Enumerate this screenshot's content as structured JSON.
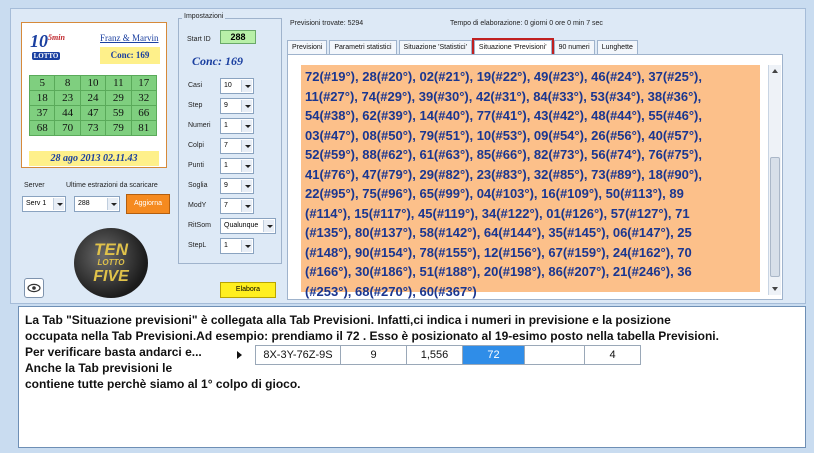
{
  "ticket": {
    "logo_main": "10",
    "logo_five": "5",
    "logo_min": "min",
    "logo_lotto": "LOTTO",
    "authors": "Franz & Marvin",
    "conc": "Conc: 169",
    "numbers": [
      5,
      8,
      10,
      11,
      17,
      18,
      23,
      24,
      29,
      32,
      37,
      44,
      47,
      59,
      66,
      68,
      70,
      73,
      79,
      81
    ],
    "date": "28 ago 2013 02.11.43"
  },
  "server": {
    "server_label": "Server",
    "extractions_label": "Ultime estrazioni da scaricare",
    "server_value": "Serv 1",
    "extractions_value": "288",
    "update_button": "Aggiorna"
  },
  "logo_tenlotto": {
    "line1": "TEN",
    "line2": "LOTTO",
    "line3": "FIVE"
  },
  "settings": {
    "title": "Impostazioni",
    "start_id_label": "Start ID",
    "start_id_value": "288",
    "conc": "Conc: 169",
    "fields": [
      {
        "label": "Casi",
        "value": "10"
      },
      {
        "label": "Step",
        "value": "9"
      },
      {
        "label": "Numeri",
        "value": "1"
      },
      {
        "label": "Colpi",
        "value": "7"
      },
      {
        "label": "Punti",
        "value": "1"
      },
      {
        "label": "Soglia",
        "value": "9"
      },
      {
        "label": "ModY",
        "value": "7"
      },
      {
        "label": "RitSom",
        "value": "Qualunque"
      },
      {
        "label": "StepL",
        "value": "1"
      }
    ],
    "elabora_button": "Elabora"
  },
  "status": {
    "found": "Previsioni trovate: 5294",
    "elapsed": "Tempo di elaborazione: 0 giorni 0 ore 0 min 7 sec"
  },
  "tabs": [
    {
      "label": "Previsioni"
    },
    {
      "label": "Parametri statistici"
    },
    {
      "label": "Situazione 'Statistici'"
    },
    {
      "label": "Situazione 'Previsioni'"
    },
    {
      "label": "90 numeri"
    },
    {
      "label": "Lunghette"
    }
  ],
  "active_tab": "Situazione 'Previsioni'",
  "predictions": [
    "72(#19°), 28(#20°), 02(#21°), 19(#22°), 49(#23°), 46(#24°), 37(#25°),",
    "11(#27°), 74(#29°), 39(#30°), 42(#31°), 84(#33°), 53(#34°), 38(#36°),",
    "54(#38°), 62(#39°), 14(#40°), 77(#41°), 43(#42°), 48(#44°), 55(#46°),",
    "03(#47°), 08(#50°), 79(#51°), 10(#53°), 09(#54°), 26(#56°), 40(#57°),",
    "52(#59°), 88(#62°), 61(#63°), 85(#66°), 82(#73°), 56(#74°), 76(#75°),",
    "41(#76°), 47(#79°), 29(#82°), 23(#83°), 32(#85°), 73(#89°), 18(#90°),",
    "22(#95°), 75(#96°), 65(#99°), 04(#103°), 16(#109°), 50(#113°), 89",
    "(#114°), 15(#117°), 45(#119°), 34(#122°), 01(#126°), 57(#127°), 71",
    "(#135°), 80(#137°), 58(#142°), 64(#144°), 35(#145°), 06(#147°), 25",
    "(#148°), 90(#154°), 78(#155°), 12(#156°), 67(#159°), 24(#162°), 70",
    "(#166°), 30(#186°), 51(#188°), 20(#198°), 86(#207°), 21(#246°), 36",
    "(#253°), 68(#270°), 60(#367°)"
  ],
  "note": {
    "line1": "La Tab \"Situazione previsioni\" è collegata alla Tab Previsioni. Infatti,ci indica i numeri in previsione e la posizione",
    "line2": "occupata nella Tab Previsioni.Ad esempio: prendiamo il 72 . Esso è posizionato al 19-esimo posto nella tabella Previsioni.",
    "line3": "Per verificare basta andarci e...",
    "line4": "Anche la Tab previsioni le",
    "line5": "contiene tutte perchè siamo al 1° colpo di gioco.",
    "row": [
      "8X-3Y-76Z-9S",
      "9",
      "1,556",
      "72",
      "",
      "4"
    ]
  }
}
